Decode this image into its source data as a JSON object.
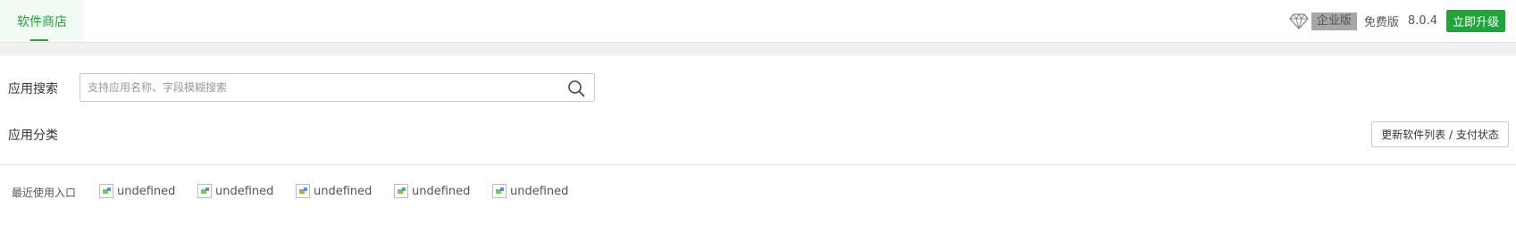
{
  "topbar": {
    "tab_label": "软件商店",
    "enterprise_badge": "企业版",
    "free_label": "免费版",
    "version": "8.0.4",
    "upgrade_label": "立即升级"
  },
  "search": {
    "label": "应用搜索",
    "placeholder": "支持应用名称、字段模糊搜索",
    "value": ""
  },
  "category": {
    "label": "应用分类",
    "refresh_button": "更新软件列表 / 支付状态"
  },
  "recent": {
    "label": "最近使用入口",
    "items": [
      {
        "label": "undefined"
      },
      {
        "label": "undefined"
      },
      {
        "label": "undefined"
      },
      {
        "label": "undefined"
      },
      {
        "label": "undefined"
      }
    ]
  },
  "colors": {
    "accent": "#20a53a",
    "badge_gray": "#a7a7a7"
  },
  "icons": {
    "diamond": "diamond-icon",
    "search": "search-icon",
    "broken_image": "broken-image-icon"
  }
}
